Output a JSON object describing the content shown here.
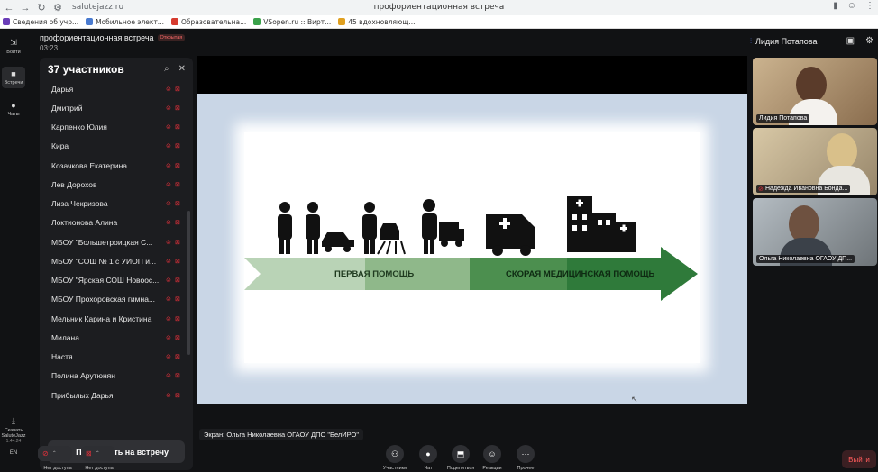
{
  "browser": {
    "url": "salutejazz.ru",
    "tab_title": "профориентационная встреча",
    "bookmarks": [
      {
        "label": "Сведения об учр...",
        "color": "#6a3db8"
      },
      {
        "label": "Мобильное элект...",
        "color": "#4a7bd0"
      },
      {
        "label": "Образовательна...",
        "color": "#d63b2f"
      },
      {
        "label": "VSopen.ru :: Вирт...",
        "color": "#3aa14a"
      },
      {
        "label": "45 вдохновляющ...",
        "color": "#e0a020"
      }
    ]
  },
  "rail": {
    "exit_label": "Войти",
    "meetings_label": "Встречи",
    "chats_label": "Чаты",
    "download_label": "Скачать SaluteJazz",
    "version": "1.44.24",
    "lang": "EN"
  },
  "meeting": {
    "title": "профориентационная встреча",
    "badge": "Открытая",
    "timer": "03:23",
    "speaker": "Лидия Потапова"
  },
  "participants": {
    "header": "37 участников",
    "list": [
      "Дарья",
      "Дмитрий",
      "Карпенко Юлия",
      "Кира",
      "Козачкова Екатерина",
      "Лев Дорохов",
      "Лиза Чекризова",
      "Локтионова Алина",
      "МБОУ \"Большетроицкая С...",
      "МБОУ \"СОШ № 1 с УИОП и...",
      "МБОУ \"Ярская СОШ Новоос...",
      "МБОУ Прохоровская гимна...",
      "Мельник Карина и Кристина",
      "Милана",
      "Настя",
      "Полина Арутюнян",
      "Прибылых Дарья"
    ],
    "invite_label": "Пригласить на встречу"
  },
  "slide": {
    "first_aid": "ПЕРВАЯ ПОМОЩЬ",
    "ambulance": "СКОРАЯ МЕДИЦИНСКАЯ ПОМОЩЬ"
  },
  "share_label": "Экран: Ольга Николаевна ОГАОУ ДПО \"БелИРО\"",
  "tiles": [
    {
      "name": "Лидия Потапова",
      "bg": "#a88c6a"
    },
    {
      "name": "Надежда Ивановна Бонда...",
      "bg": "#b9a98a"
    },
    {
      "name": "Ольга Николаевна ОГАОУ ДП...",
      "bg": "#8c9297"
    }
  ],
  "controls": {
    "mic_label": "Нет доступа",
    "cam_label": "Нет доступа",
    "participants": "Участники",
    "chat": "Чат",
    "share": "Поделиться",
    "reactions": "Реакции",
    "more": "Прочее",
    "exit": "Выйти"
  },
  "colors": {
    "accent_red": "#e0303a",
    "arrow_light": "#b9d3b6",
    "arrow_mid": "#8fb88a",
    "arrow_dark": "#2f7a3a"
  }
}
